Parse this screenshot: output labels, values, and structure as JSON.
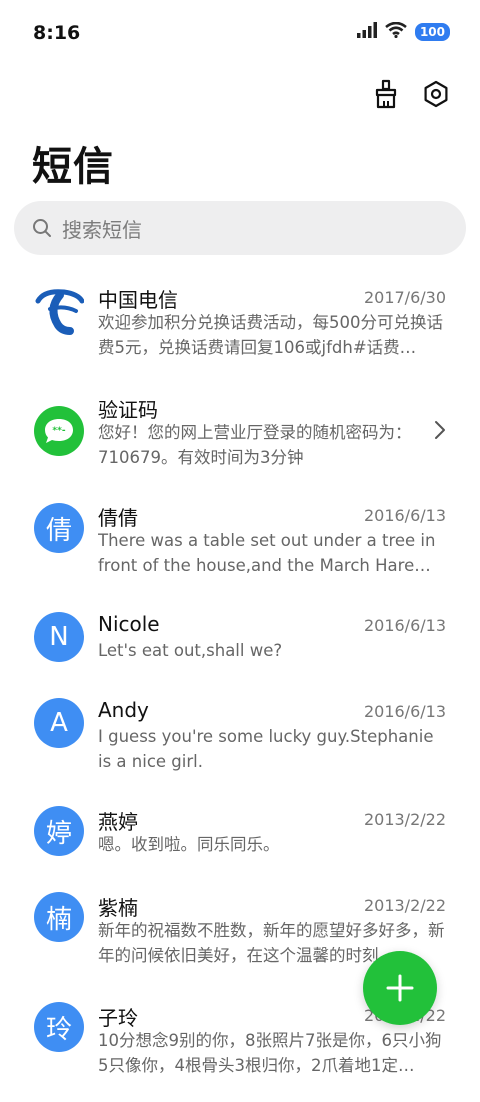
{
  "status_bar": {
    "time": "8:16",
    "battery": "100"
  },
  "title": "短信",
  "search": {
    "placeholder": "搜索短信"
  },
  "conversations": [
    {
      "avatar_text": "",
      "avatar_icon": "china-telecom-logo",
      "name": "中国电信",
      "date": "2017/6/30",
      "preview": "欢迎参加积分兑换话费活动，每500分可兑换话费5元，兑换话费请回复106或jfdh#话费…"
    },
    {
      "avatar_text": "",
      "avatar_icon": "message-bubble-icon",
      "name": "验证码",
      "date": "",
      "preview": "您好！您的网上营业厅登录的随机密码为：710679。有效时间为3分钟"
    },
    {
      "avatar_text": "倩",
      "name": "倩倩",
      "date": "2016/6/13",
      "preview": "There was a table set out under a tree in front of the house,and the March Hare an…"
    },
    {
      "avatar_text": "N",
      "name": "Nicole",
      "date": "2016/6/13",
      "preview": "Let's eat out,shall we?"
    },
    {
      "avatar_text": "A",
      "name": "Andy",
      "date": "2016/6/13",
      "preview": "I guess you're some lucky guy.Stephanie is a nice girl."
    },
    {
      "avatar_text": "婷",
      "name": "燕婷",
      "date": "2013/2/22",
      "preview": "嗯。收到啦。同乐同乐。"
    },
    {
      "avatar_text": "楠",
      "name": "紫楠",
      "date": "2013/2/22",
      "preview": "新年的祝福数不胜数，新年的愿望好多好多，新年的问候依旧美好，在这个温馨的时刻…"
    },
    {
      "avatar_text": "玲",
      "name": "子玲",
      "date": "2013/2/22",
      "preview": "10分想念9别的你，8张照片7张是你，6只小狗5只像你，4根骨头3根归你，2爪着地1定…"
    }
  ],
  "colors": {
    "avatar_blue": "#3f8ef3",
    "fab_green": "#22c13a",
    "verify_green": "#22c13a",
    "telecom_blue": "#1a5db8"
  }
}
